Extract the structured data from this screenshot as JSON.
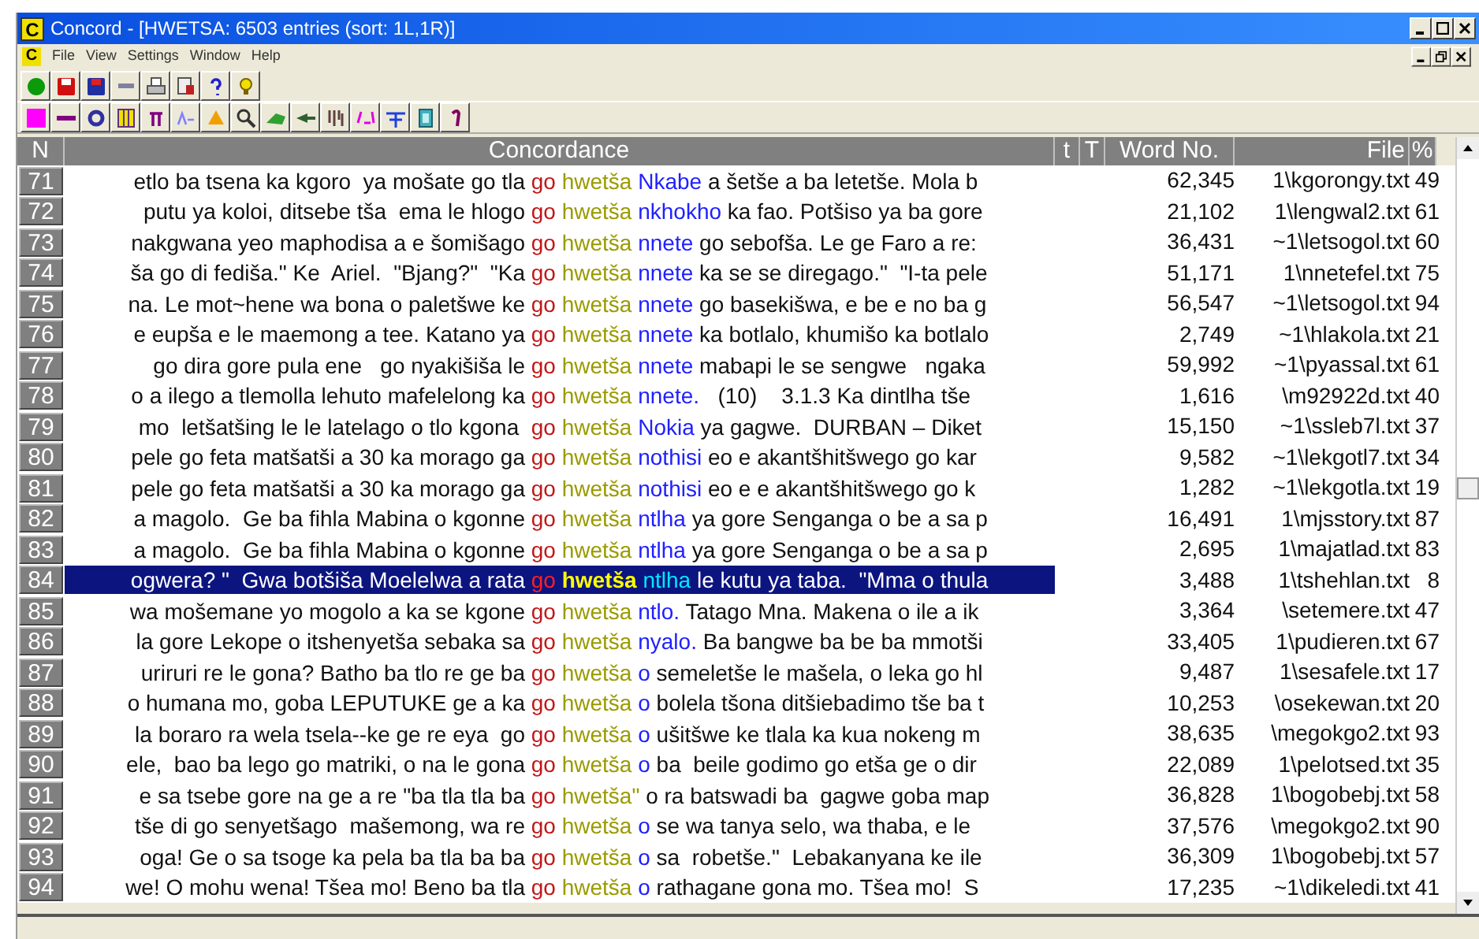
{
  "window": {
    "app_icon": "C",
    "title": "Concord - [HWETSA: 6503 entries (sort: 1L,1R)]"
  },
  "menu": {
    "app_icon": "C",
    "items": [
      "File",
      "View",
      "Settings",
      "Window",
      "Help"
    ]
  },
  "table": {
    "columns": [
      "N",
      "Concordance",
      "t",
      "T",
      "Word No.",
      "File",
      "%"
    ],
    "rows": [
      {
        "n": "71",
        "left": "etlo ba tsena ka kgoro  ya mošate go tla",
        "prefix": "go",
        "node": "hwetša",
        "collocate": "Nkabe",
        "right": "a šetše a ba letetše. Mola b",
        "word_no": "62,345",
        "file": "1\\kgorongy.txt",
        "pct": "49",
        "selected": false
      },
      {
        "n": "72",
        "left": "putu ya koloi, ditsebe tša  ema le hlogo",
        "prefix": "go",
        "node": "hwetša",
        "collocate": "nkhokho",
        "right": "ka fao. Potšiso ya ba gore",
        "word_no": "21,102",
        "file": "1\\lengwal2.txt",
        "pct": "61",
        "selected": false
      },
      {
        "n": "73",
        "left": "nakgwana yeo maphodisa a e šomišago",
        "prefix": "go",
        "node": "hwetša",
        "collocate": "nnete",
        "right": "go sebofša. Le ge Faro a re:",
        "word_no": "36,431",
        "file": "~1\\letsogol.txt",
        "pct": "60",
        "selected": false
      },
      {
        "n": "74",
        "left": "ša go di fediša.\" Ke  Ariel.  \"Bjang?\"  \"Ka",
        "prefix": "go",
        "node": "hwetša",
        "collocate": "nnete",
        "right": "ka se se diregago.\"  \"I-ta pele",
        "word_no": "51,171",
        "file": "1\\nnetefel.txt",
        "pct": "75",
        "selected": false
      },
      {
        "n": "75",
        "left": "na. Le mot~hene wa bona o paletšwe ke",
        "prefix": "go",
        "node": "hwetša",
        "collocate": "nnete",
        "right": "go basekišwa, e be e no ba g",
        "word_no": "56,547",
        "file": "~1\\letsogol.txt",
        "pct": "94",
        "selected": false
      },
      {
        "n": "76",
        "left": "e eupša e le maemong a tee. Katano ya",
        "prefix": "go",
        "node": "hwetša",
        "collocate": "nnete",
        "right": "ka botlalo, khumišo ka botlalo",
        "word_no": "2,749",
        "file": "~1\\hlakola.txt",
        "pct": "21",
        "selected": false
      },
      {
        "n": "77",
        "left": "go dira gore pula ene   go nyakišiša le",
        "prefix": "go",
        "node": "hwetša",
        "collocate": "nnete",
        "right": "mabapi le se sengwe   ngaka",
        "word_no": "59,992",
        "file": "~1\\pyassal.txt",
        "pct": "61",
        "selected": false
      },
      {
        "n": "78",
        "left": "o a ilego a tlemolla lehuto mafelelong ka",
        "prefix": "go",
        "node": "hwetša",
        "collocate": "nnete.",
        "right": "  (10)    3.1.3 Ka dintlha tše",
        "word_no": "1,616",
        "file": "\\m92922d.txt",
        "pct": "40",
        "selected": false
      },
      {
        "n": "79",
        "left": "mo  letšatšing le le latelago o tlo kgona ",
        "prefix": "go",
        "node": "hwetša",
        "collocate": "Nokia",
        "right": "ya gagwe.  DURBAN – Diket",
        "word_no": "15,150",
        "file": "~1\\ssleb7l.txt",
        "pct": "37",
        "selected": false
      },
      {
        "n": "80",
        "left": "pele go feta matšatši a 30 ka morago ga",
        "prefix": "go",
        "node": "hwetša",
        "collocate": "nothisi",
        "right": "eo e akantšhitšwego go kar",
        "word_no": "9,582",
        "file": "~1\\lekgotl7.txt",
        "pct": "34",
        "selected": false
      },
      {
        "n": "81",
        "left": "pele go feta matšatši a 30 ka morago ga",
        "prefix": "go",
        "node": "hwetša",
        "collocate": "nothisi",
        "right": "eo e e akantšhitšwego go k",
        "word_no": "1,282",
        "file": "~1\\lekgotla.txt",
        "pct": "19",
        "selected": false
      },
      {
        "n": "82",
        "left": "a magolo.  Ge ba fihla Mabina o kgonne",
        "prefix": "go",
        "node": "hwetša",
        "collocate": "ntlha",
        "right": "ya gore Senganga o be a sa p",
        "word_no": "16,491",
        "file": "1\\mjsstory.txt",
        "pct": "87",
        "selected": false
      },
      {
        "n": "83",
        "left": "a magolo.  Ge ba fihla Mabina o kgonne",
        "prefix": "go",
        "node": "hwetša",
        "collocate": "ntlha",
        "right": "ya gore Senganga o be a sa p",
        "word_no": "2,695",
        "file": "1\\majatlad.txt",
        "pct": "83",
        "selected": false
      },
      {
        "n": "84",
        "left": "ogwera? \"  Gwa botšiša Moelelwa a rata",
        "prefix": "go",
        "node": "hwetša",
        "collocate": "ntlha",
        "right": "le kutu ya taba.  \"Mma o thula",
        "word_no": "3,488",
        "file": "1\\tshehlan.txt",
        "pct": "8",
        "selected": true
      },
      {
        "n": "85",
        "left": "wa mošemane yo mogolo a ka se kgone",
        "prefix": "go",
        "node": "hwetša",
        "collocate": "ntlo.",
        "right": "Tatago Mna. Makena o ile a ik",
        "word_no": "3,364",
        "file": "\\setemere.txt",
        "pct": "47",
        "selected": false
      },
      {
        "n": "86",
        "left": "la gore Lekope o itshenyetša sebaka sa",
        "prefix": "go",
        "node": "hwetša",
        "collocate": "nyalo.",
        "right": "Ba bangwe ba be ba mmotši",
        "word_no": "33,405",
        "file": "1\\pudieren.txt",
        "pct": "67",
        "selected": false
      },
      {
        "n": "87",
        "left": "uriruri re le gona? Batho ba tlo re ge ba",
        "prefix": "go",
        "node": "hwetša",
        "collocate": "o",
        "right": "semeletše le mašela, o leka go hl",
        "word_no": "9,487",
        "file": "1\\sesafele.txt",
        "pct": "17",
        "selected": false
      },
      {
        "n": "88",
        "left": "o humana mo, goba LEPUTUKE ge a ka",
        "prefix": "go",
        "node": "hwetša",
        "collocate": "o",
        "right": "bolela tšona ditšiebadimo tše ba t",
        "word_no": "10,253",
        "file": "\\osekewan.txt",
        "pct": "20",
        "selected": false
      },
      {
        "n": "89",
        "left": "la boraro ra wela tsela--ke ge re eya  go",
        "prefix": "go",
        "node": "hwetša",
        "collocate": "o",
        "right": "ušitšwe ke tlala ka kua nokeng m",
        "word_no": "38,635",
        "file": "\\megokgo2.txt",
        "pct": "93",
        "selected": false
      },
      {
        "n": "90",
        "left": "ele,  bao ba lego go matriki, o na le gona",
        "prefix": "go",
        "node": "hwetša",
        "collocate": "o",
        "right": "ba  beile godimo go etša ge o dir",
        "word_no": "22,089",
        "file": "1\\pelotsed.txt",
        "pct": "35",
        "selected": false
      },
      {
        "n": "91",
        "left": "e sa tsebe gore na ge a re \"ba tla tla ba",
        "prefix": "go",
        "node": "hwetša\"",
        "right": "o ra batswadi ba  gagwe goba map",
        "word_no": "36,828",
        "file": "1\\bogobebj.txt",
        "pct": "58",
        "selected": false
      },
      {
        "n": "92",
        "left": "tše di go senyetšago  mašemong, wa re",
        "prefix": "go",
        "node": "hwetša",
        "collocate": "o",
        "right": "se wa tanya selo, wa thaba, e le",
        "word_no": "37,576",
        "file": "\\megokgo2.txt",
        "pct": "90",
        "selected": false
      },
      {
        "n": "93",
        "left": "oga! Ge o sa tsoge ka pela ba tla ba ba",
        "prefix": "go",
        "node": "hwetša",
        "collocate": "o",
        "right": "sa  robetše.\"  Lebakanyana ke ile",
        "word_no": "36,309",
        "file": "1\\bogobebj.txt",
        "pct": "57",
        "selected": false
      },
      {
        "n": "94",
        "left": "we! O mohu wena! Tšea mo! Beno ba tla",
        "prefix": "go",
        "node": "hwetša",
        "collocate": "o",
        "right": "rathagane gona mo. Tšea mo!  S",
        "word_no": "17,235",
        "file": "~1\\dikeledi.txt",
        "pct": "41",
        "selected": false
      }
    ]
  }
}
